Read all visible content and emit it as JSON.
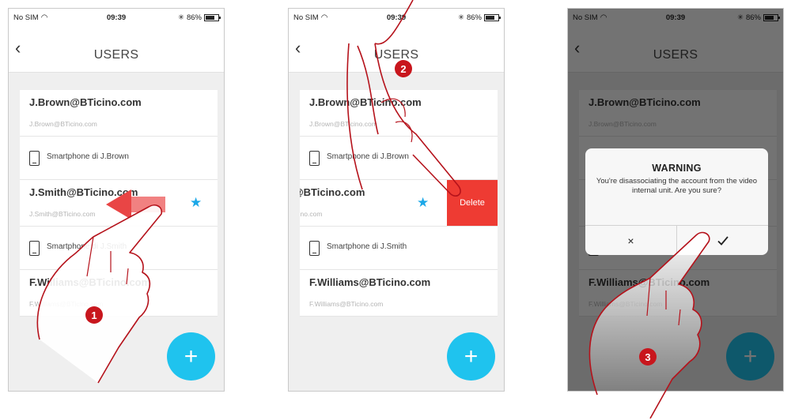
{
  "status_bar": {
    "carrier": "No SIM",
    "time": "09:39",
    "battery": "86%"
  },
  "header": {
    "title": "USERS",
    "back_icon": "chevron-left-icon"
  },
  "users": [
    {
      "email": "J.Brown@BTicino.com",
      "sub": "J.Brown@BTicino.com",
      "device": "Smartphone di J.Brown"
    },
    {
      "email": "J.Smith@BTicino.com",
      "sub": "J.Smith@BTicino.com",
      "device": "Smartphone di J.Smith",
      "favorite": true
    },
    {
      "email": "F.Williams@BTicino.com",
      "sub": "F.Williams@BTicino.com"
    }
  ],
  "swipe_action": {
    "label": "Delete",
    "color": "#ee3b33"
  },
  "fab": {
    "label": "+"
  },
  "dialog": {
    "title": "WARNING",
    "message": "You're disassociating the account from the video internal unit. Are you sure?",
    "cancel": "×"
  },
  "steps": [
    "1",
    "2",
    "3"
  ],
  "colors": {
    "accent": "#1fc3ee",
    "star": "#1ca8e8",
    "step_badge": "#c8161d",
    "annotation": "#b5121b"
  }
}
